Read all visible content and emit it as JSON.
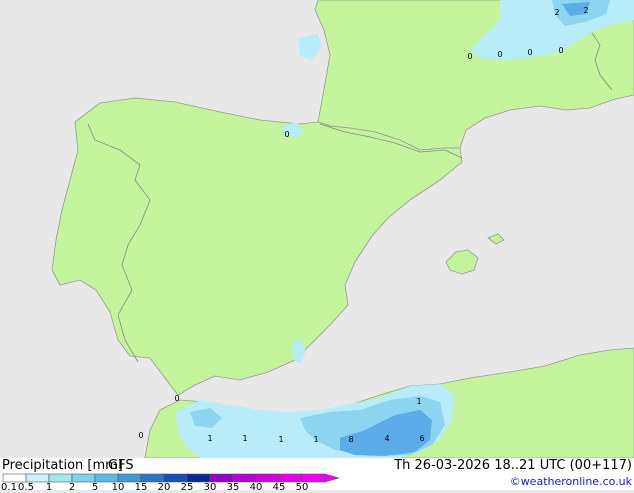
{
  "footer": {
    "title": "Precipitation [mm]",
    "model": "GFS",
    "datetime": "Th 26-03-2026 18..21 UTC (00+117)",
    "credit": "©weatheronline.co.uk"
  },
  "legend": {
    "ticks": [
      "0.1",
      "0.5",
      "1",
      "2",
      "5",
      "10",
      "15",
      "20",
      "25",
      "30",
      "35",
      "40",
      "45",
      "50"
    ],
    "colors": [
      "#ffffff",
      "#c8f4f8",
      "#a0e6f4",
      "#7ed2ec",
      "#5abce6",
      "#3c9ad8",
      "#2878c8",
      "#1450b4",
      "#0a2896",
      "#9600c8",
      "#b400d2",
      "#d200dc",
      "#e600e6",
      "#f000f0"
    ]
  },
  "colors": {
    "sea": "#e8e8e8",
    "land": "#c4f49c",
    "border": "#888888",
    "precip_light": "#b8ecf8",
    "precip_mid": "#8cd4f0",
    "precip_strong": "#5cacea"
  },
  "map_labels": {
    "france_ne": [
      "2",
      "2"
    ],
    "france_n": [
      "0",
      "0",
      "0",
      "0"
    ],
    "bilbao": "0",
    "gibraltar": "0",
    "morocco": "0",
    "algeria": [
      "1",
      "1",
      "1",
      "1",
      "8",
      "4",
      "6",
      "1"
    ]
  }
}
